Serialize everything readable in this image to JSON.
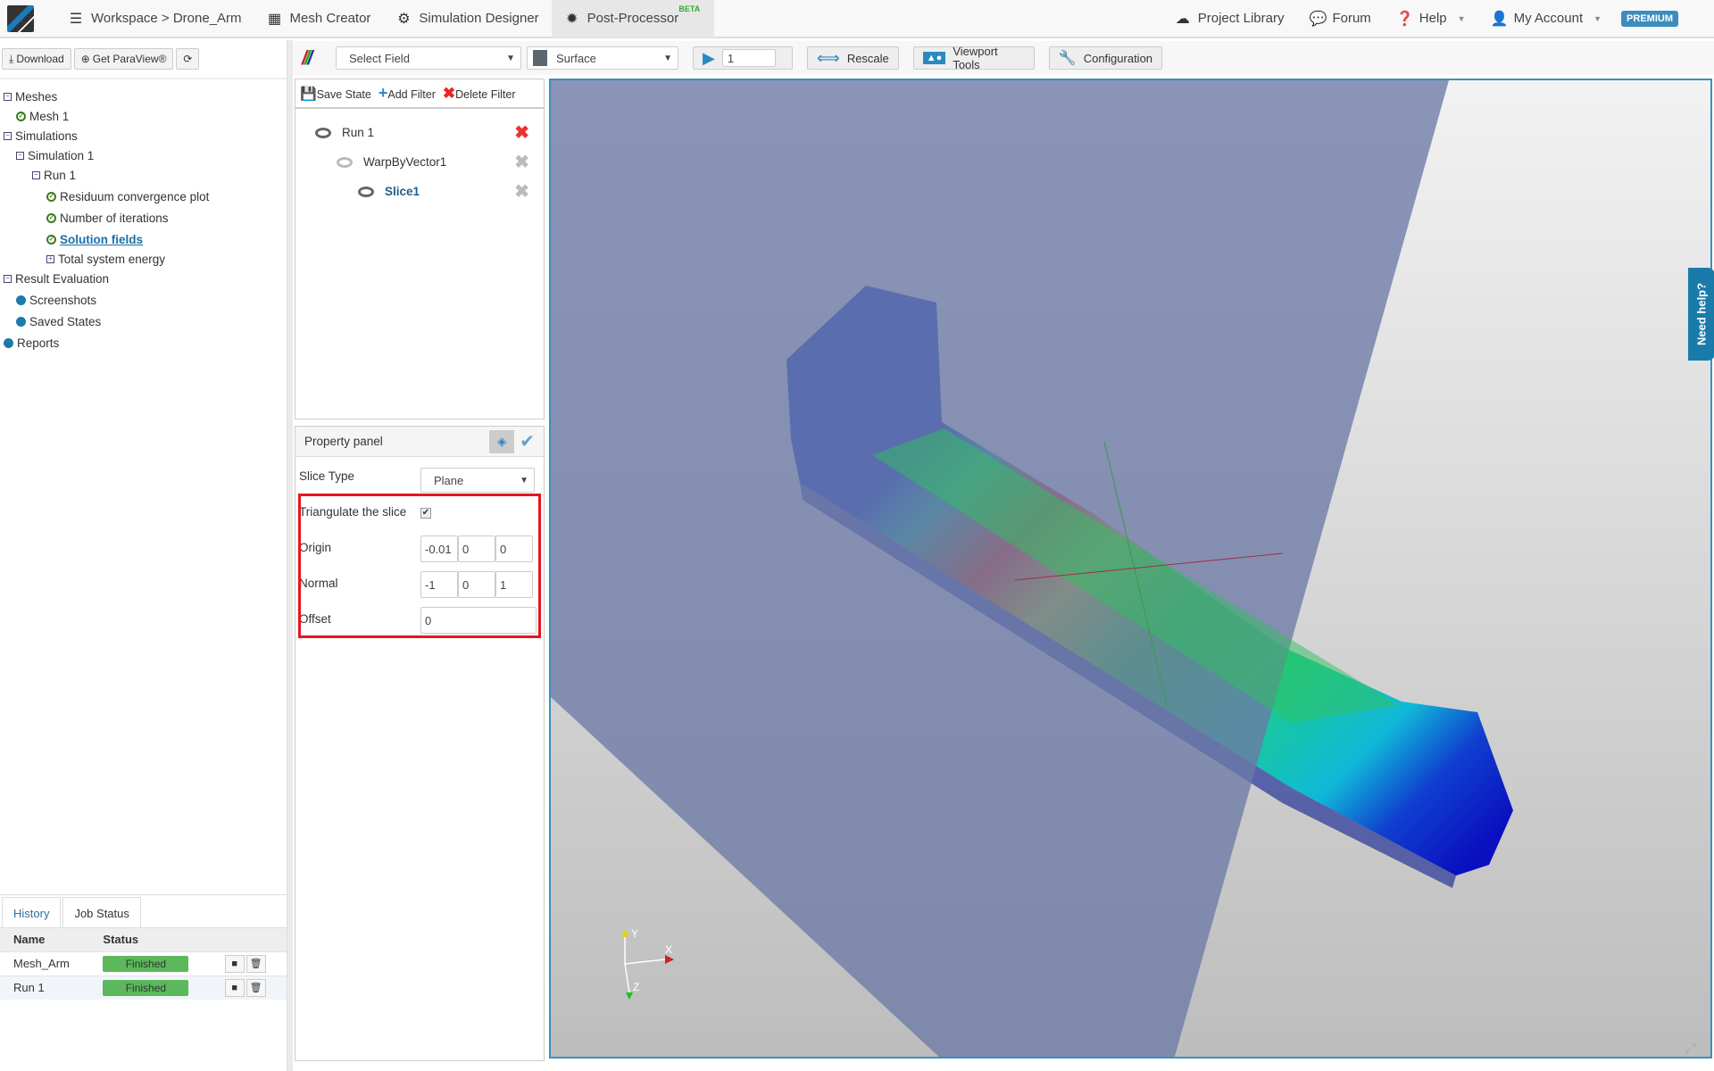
{
  "nav": {
    "items": [
      {
        "label": "Workspace > Drone_Arm",
        "icon": "server-icon"
      },
      {
        "label": "Mesh Creator",
        "icon": "grid-icon"
      },
      {
        "label": "Simulation Designer",
        "icon": "gears-icon"
      },
      {
        "label": "Post-Processor",
        "icon": "gear-icon",
        "badge": "BETA"
      }
    ],
    "right": [
      {
        "label": "Project Library",
        "icon": "cloud-download-icon"
      },
      {
        "label": "Forum",
        "icon": "comment-icon"
      },
      {
        "label": "Help",
        "icon": "question-icon"
      },
      {
        "label": "My Account",
        "icon": "user-icon"
      }
    ],
    "premium": "PREMIUM"
  },
  "left": {
    "buttons": {
      "download": "Download",
      "paraview": "Get ParaView®"
    },
    "tree": {
      "meshes": "Meshes",
      "mesh1": "Mesh 1",
      "simulations": "Simulations",
      "sim1": "Simulation 1",
      "run1": "Run 1",
      "residuum": "Residuum convergence plot",
      "iterations": "Number of iterations",
      "solution": "Solution fields",
      "energy": "Total system energy",
      "result_eval": "Result Evaluation",
      "screenshots": "Screenshots",
      "saved_states": "Saved States",
      "reports": "Reports"
    }
  },
  "jobs": {
    "tabs": [
      "History",
      "Job Status"
    ],
    "headers": [
      "Name",
      "Status"
    ],
    "rows": [
      {
        "name": "Mesh_Arm",
        "status": "Finished"
      },
      {
        "name": "Run 1",
        "status": "Finished"
      }
    ]
  },
  "toolbar": {
    "field": "Select Field",
    "representation": "Surface",
    "timestep": "1",
    "rescale": "Rescale",
    "viewport_tools": "Viewport Tools",
    "configuration": "Configuration"
  },
  "filters": {
    "save": "Save State",
    "add": "Add Filter",
    "delete": "Delete Filter",
    "items": [
      "Run 1",
      "WarpByVector1",
      "Slice1"
    ]
  },
  "property": {
    "title": "Property panel",
    "slice_type_label": "Slice Type",
    "slice_type": "Plane",
    "triangulate_label": "Triangulate the slice",
    "triangulate": true,
    "origin_label": "Origin",
    "origin": [
      "-0.01",
      "0",
      "0"
    ],
    "normal_label": "Normal",
    "normal": [
      "-1",
      "0",
      "1"
    ],
    "offset_label": "Offset",
    "offset": "0"
  },
  "viewport": {
    "axes": [
      "Y",
      "X",
      "Z"
    ]
  },
  "help": "Need help?",
  "colors": {
    "accent": "#1a7bab",
    "finished": "#5cb85c",
    "highlight": "#e8141e"
  }
}
